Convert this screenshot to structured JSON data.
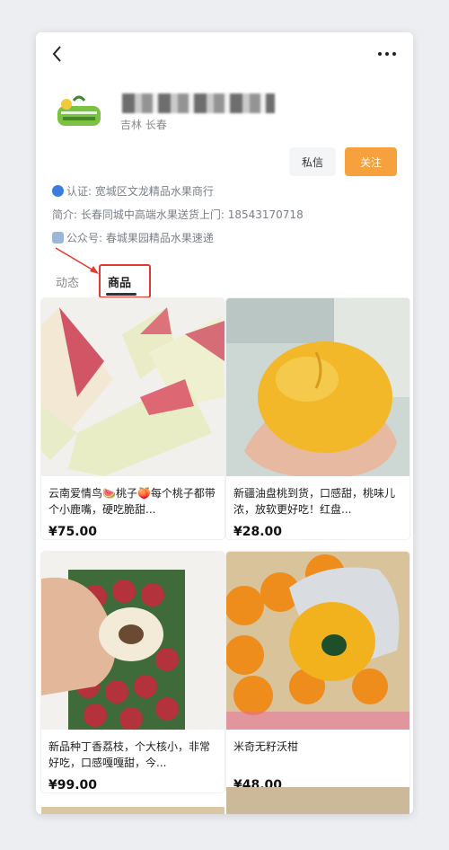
{
  "header": {
    "back_icon": "chevron-left-icon",
    "more_icon": "more-dots-icon"
  },
  "profile": {
    "location": "吉林 长春",
    "message_label": "私信",
    "follow_label": "关注",
    "verified_text": "认证: 宽城区文龙精品水果商行",
    "intro_text": "简介: 长春同城中高端水果送货上门: 18543170718",
    "account_text": "公众号: 春城果园精品水果速递"
  },
  "tabs": [
    {
      "label": "动态"
    },
    {
      "label": "商品"
    }
  ],
  "products": [
    {
      "title": "云南爱情鸟🍉桃子🍑每个桃子都带个小鹿嘴，硬吃脆甜...",
      "price": "¥75.00"
    },
    {
      "title": "新疆油盘桃到货，口感甜，桃味儿浓，放软更好吃！红盘...",
      "price": "¥28.00"
    },
    {
      "title": "新品种丁香荔枝，个大核小，非常好吃，口感嘎嘎甜，今...",
      "price": "¥99.00"
    },
    {
      "title": "米奇无籽沃柑",
      "price": "¥48.00"
    }
  ],
  "colors": {
    "accent": "#f6a13e",
    "highlight": "#e03a2f",
    "verified": "#3b7ddd"
  }
}
